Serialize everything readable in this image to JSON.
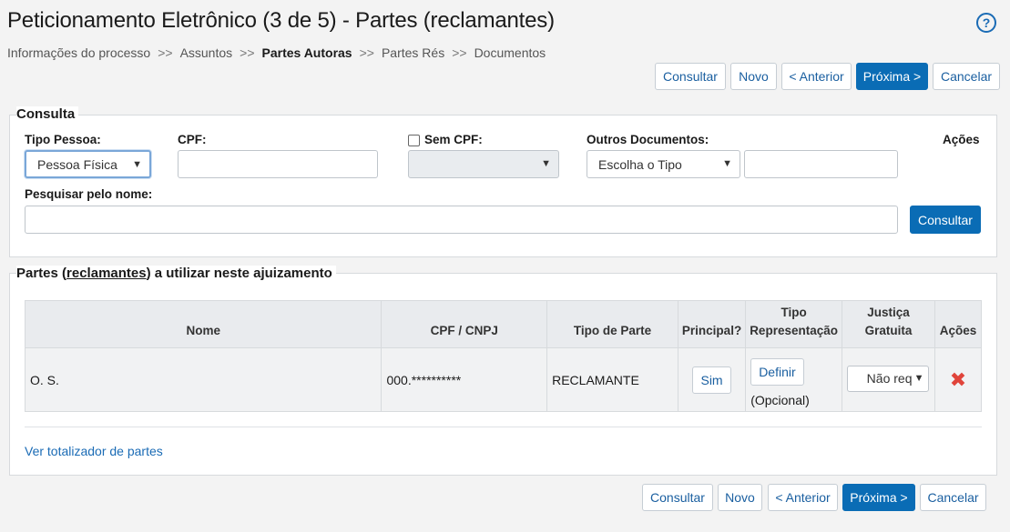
{
  "header": {
    "title": "Peticionamento Eletrônico (3 de 5) - Partes (reclamantes)",
    "help_icon": "?"
  },
  "breadcrumb": {
    "separator": ">>",
    "items": [
      "Informações do processo",
      "Assuntos",
      "Partes Autoras",
      "Partes Rés",
      "Documentos"
    ],
    "current_index": 2
  },
  "toolbar": {
    "consultar": "Consultar",
    "novo": "Novo",
    "anterior": "< Anterior",
    "proxima": "Próxima >",
    "cancelar": "Cancelar"
  },
  "consulta": {
    "legend": "Consulta",
    "tipo_pessoa_label": "Tipo Pessoa:",
    "tipo_pessoa_value": "Pessoa Física",
    "cpf_label": "CPF:",
    "cpf_value": "",
    "sem_cpf_label": "Sem CPF:",
    "sem_cpf_checked": false,
    "sem_cpf_select_value": "",
    "outros_documentos_label": "Outros Documentos:",
    "outros_documentos_select": "Escolha o Tipo",
    "outros_documentos_value": "",
    "acoes_label": "Ações",
    "pesquisar_nome_label": "Pesquisar pelo nome:",
    "pesquisar_nome_value": "",
    "consultar_button": "Consultar"
  },
  "partes": {
    "legend_prefix": "Partes (",
    "legend_link": "reclamantes",
    "legend_suffix": ") a utilizar neste ajuizamento",
    "columns": [
      "Nome",
      "CPF / CNPJ",
      "Tipo de Parte",
      "Principal?",
      "Tipo Representação",
      "Justiça Gratuita",
      "Ações"
    ],
    "rows": [
      {
        "nome": "O. S.",
        "cpf": "000.**********",
        "tipo_parte": "RECLAMANTE",
        "principal_button": "Sim",
        "representacao_button": "Definir",
        "representacao_note": "(Opcional)",
        "justica_gratuita": "Não requ",
        "delete_icon": "✖"
      }
    ],
    "totalizador_link": "Ver totalizador de partes"
  },
  "colors": {
    "primary": "#0a6cb5",
    "link": "#1a6bb5",
    "delete": "#e0443a",
    "background": "#f3f3f3"
  }
}
